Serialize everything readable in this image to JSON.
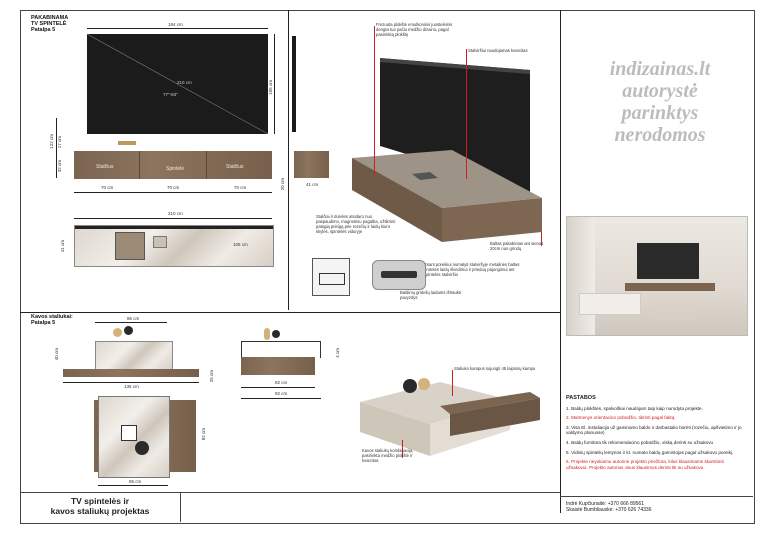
{
  "top_left": {
    "heading": [
      "PAKABINAMA",
      "TV SPINTELĖ",
      "Patalpa 5"
    ],
    "dims": {
      "tv_width": "184 cm",
      "tv_height": "105 cm",
      "tv_diag": "210 cm",
      "tv_inch": "77\"-83\"",
      "gap": "17 cm",
      "total_h": "122 cm",
      "cab_h": "32 cm",
      "side_h": "20 cm",
      "seg1": "70 cm",
      "seg2": "70 cm",
      "seg3": "70 cm",
      "depth": "41 cm",
      "plan_w": "210 cm",
      "plan_d": "41 cm",
      "plan_inner": "105 cm"
    },
    "drawer_labels": [
      "Stalčius",
      "Spintelė",
      "Stalčius"
    ]
  },
  "callouts_top": {
    "c1": "Frezuota plokštė emulkoninis juostelėmis dengta tuo pačiu medžio dizainu, pagal pasirinktą plokštę",
    "c2": "Stalviršiui naudojamas kvarcitas",
    "c3": "Stalčiai ir dureles atsidaro nuo paspaudimo, magnetiniu pagalba, užtikrinti patogią prieigą prie rozečių ir laidų kiuro skylės, spintelės viduryje",
    "c4": "Baltas pakabintas ant sienos 20cm nuo grindų",
    "c5": "Esant poreikiui numatyti stalviršyje metalinės baltas groteles laidų išvedimui ir prieduų pajungimui ant spintelės stalviršio",
    "c6": "Baldinių grotelių laidams ištraukti pavyzdys"
  },
  "watermark": [
    "indizainas.lt",
    "autorystė",
    "parinktys",
    "nerodomos"
  ],
  "bottom_left": {
    "heading": [
      "Kavos staliukai:",
      "Patalpa 5"
    ],
    "dims": {
      "top_w": "86 cm",
      "h40": "40 cm",
      "total_w": "135 cm",
      "h25": "25 cm",
      "side_w1": "82 cm",
      "side_w2": "92 cm",
      "side_h4": "4 cm",
      "plan_side": "82 cm",
      "plan_bottom": "86 cm"
    }
  },
  "callouts_bottom": {
    "c1": "Staliuko kampus sujungti 45 laipsnių kampu",
    "c2": "Kavos staliukų kombinacija, pasirinkta medžio plokštė ir kvarcitas"
  },
  "notes": {
    "title": "PASTABOS",
    "items": [
      {
        "text": "1. Baldų plokštės, spalvoškai naudojam taip kaip nurodyta projekte.",
        "red": false
      },
      {
        "text": "2. Matmenys orientacino pobūdžio, tikrinti pagal faktą.",
        "red": true
      },
      {
        "text": "3. Visa El. instaliacija už gaminamo baldo ir darbastalio būrėti (rozečiu, apšvietimo ir jo valdymo planuose)",
        "red": false
      },
      {
        "text": "4. Baldų furnitūra tik rekomendacino pobūdžio, viską derinti su užsakovu",
        "red": false
      },
      {
        "text": "5. Vidinių spintelių lentynos ir kt. numato baldų gamintojas pagal užsakovo poreikį.",
        "red": false
      },
      {
        "text": "6. Projekte neyokiamu autorinė projekto priežiūra, kilus klausimams skambinti užsakovui. Projekto autorius visus klausimus derinti tik su užsakovu.",
        "red": true
      }
    ]
  },
  "title_block": {
    "title": [
      "TV spintelės ir",
      "kavos staliukų projektas"
    ],
    "contact1": "Indrė Kupčiunaitė: +370 666 89561",
    "contact2": "Skaistė Bumbliauskė: +370 626 74336"
  },
  "colors": {
    "wood": "#7b6551",
    "marble": "#e8e3dc",
    "accent_red": "#d21d1d",
    "tv_black": "#1b1b1b"
  }
}
